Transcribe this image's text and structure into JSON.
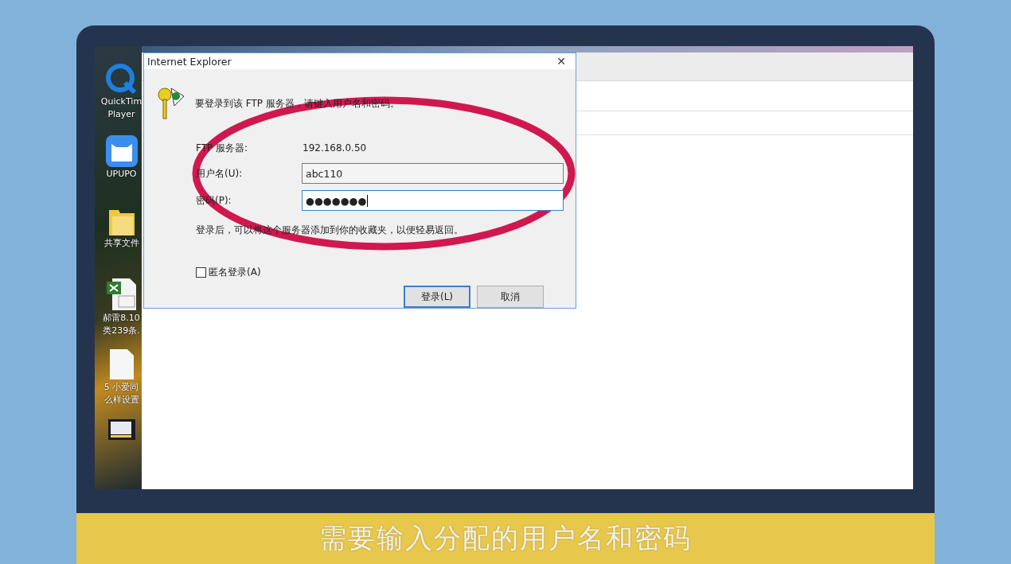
{
  "desktop_icons": [
    {
      "kind": "quicktime",
      "lines": [
        "QuickTim",
        "Player"
      ]
    },
    {
      "kind": "mascot",
      "lines": [
        "UPUPO"
      ]
    },
    {
      "kind": "folder",
      "lines": [
        "共享文件"
      ]
    },
    {
      "kind": "excel",
      "lines": [
        "郝雷8.10",
        "类239条."
      ]
    },
    {
      "kind": "file",
      "lines": [
        "5 小爱同",
        "么样设置"
      ]
    },
    {
      "kind": "video"
    }
  ],
  "dialog": {
    "title": "Internet Explorer",
    "close": "✕",
    "message": "要登录到该 FTP 服务器，请键入用户名和密码。",
    "fields": [
      {
        "kind": "static",
        "label": "FTP 服务器:",
        "value": "192.168.0.50"
      },
      {
        "kind": "input",
        "label": "用户名(U):",
        "value": "abc110",
        "focused": false
      },
      {
        "kind": "input",
        "label": "密码(P):",
        "value": "●●●●●●●",
        "focused": true
      }
    ],
    "note": "登录后，可以将这个服务器添加到你的收藏夹，以便轻易返回。",
    "anonymous": {
      "label": "匿名登录(A)",
      "checked": false
    },
    "buttons": [
      {
        "label": "登录(L)",
        "default": true
      },
      {
        "label": "取消",
        "default": false
      }
    ]
  },
  "subtitle": "需要输入分配的用户名和密码"
}
